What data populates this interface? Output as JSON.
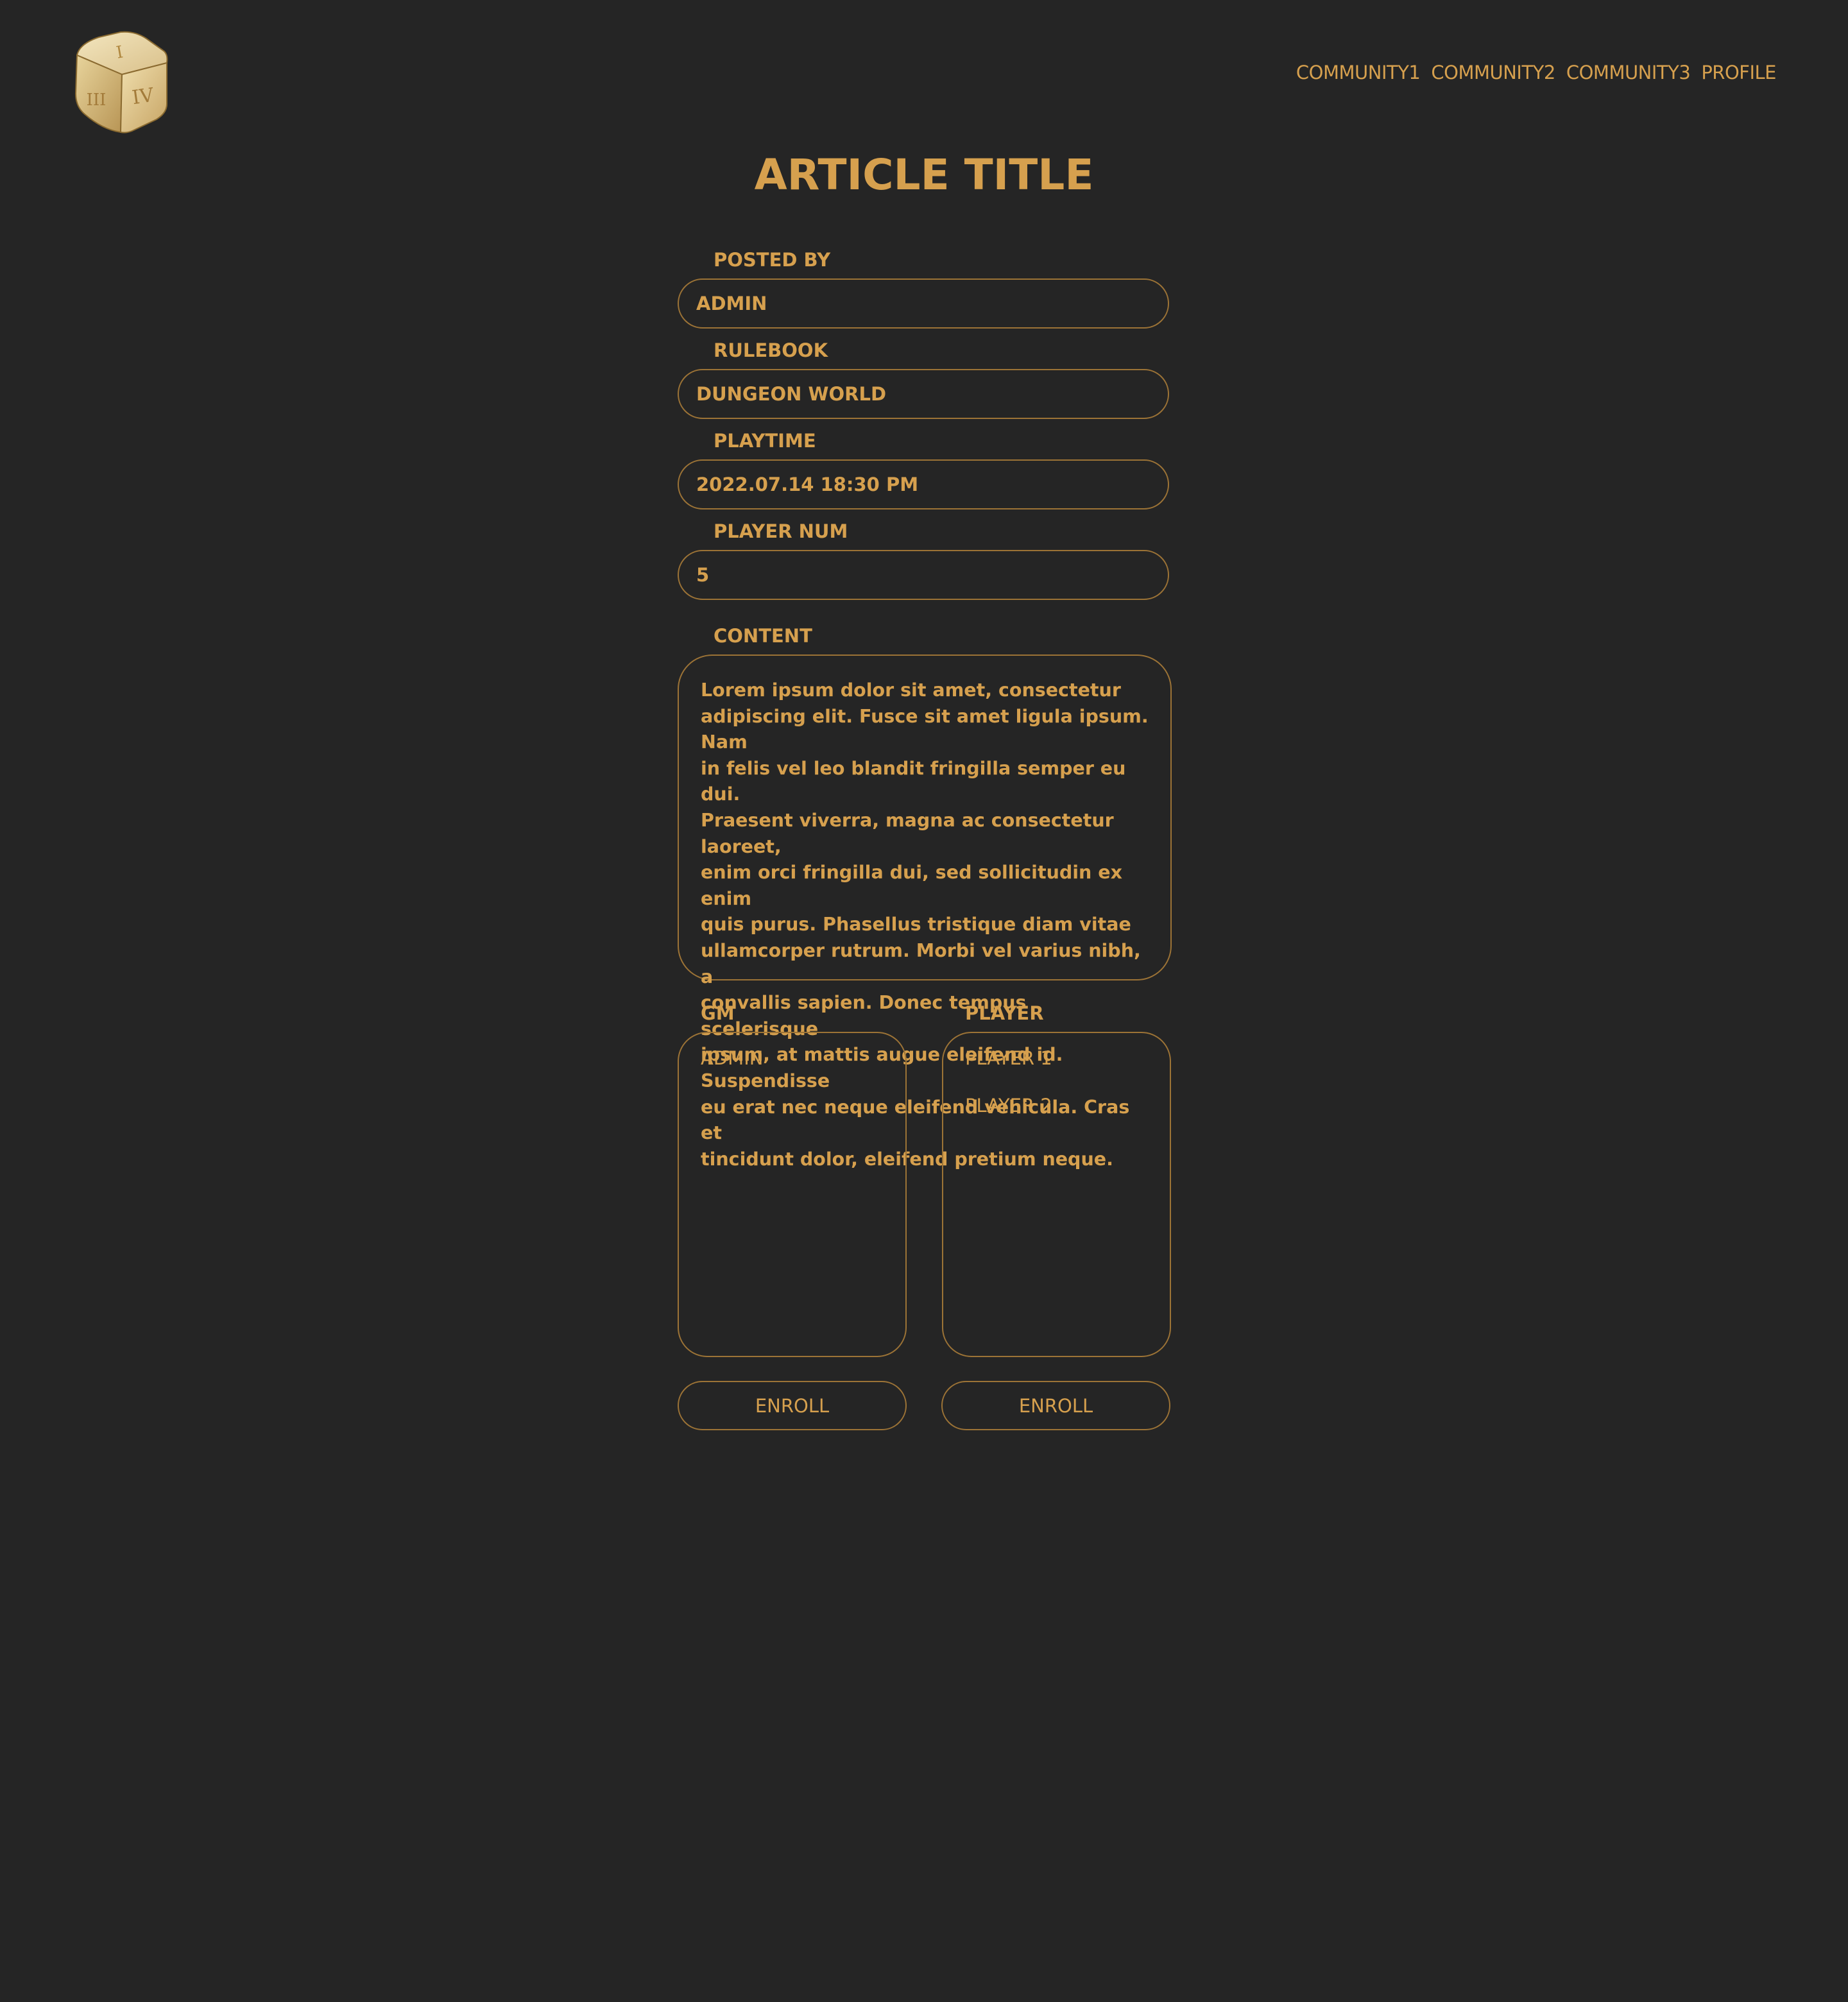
{
  "header": {
    "logo_icon": "dice-logo",
    "nav": [
      {
        "label": "COMMUNITY1"
      },
      {
        "label": "COMMUNITY2"
      },
      {
        "label": "COMMUNITY3"
      },
      {
        "label": "PROFILE"
      }
    ]
  },
  "article": {
    "title": "ARTICLE TITLE",
    "posted_by": {
      "label": "POSTED BY",
      "value": "ADMIN"
    },
    "rulebook": {
      "label": "RULEBOOK",
      "value": "DUNGEON WORLD"
    },
    "playtime": {
      "label": "PLAYTIME",
      "value": "2022.07.14 18:30 PM"
    },
    "player_num": {
      "label": "PLAYER NUM",
      "value": "5"
    },
    "content": {
      "label": "CONTENT",
      "lines": [
        "Lorem ipsum dolor sit amet, consectetur",
        "adipiscing elit. Fusce sit amet ligula ipsum. Nam",
        "in felis vel leo blandit fringilla semper eu dui.",
        "Praesent viverra, magna ac consectetur laoreet,",
        "enim orci fringilla dui, sed sollicitudin ex enim",
        "quis purus. Phasellus tristique diam vitae",
        "ullamcorper rutrum. Morbi vel varius nibh, a",
        "convallis sapien. Donec tempus scelerisque",
        "ipsum, at mattis augue eleifend id. Suspendisse",
        "eu erat nec neque eleifend vehicula. Cras et",
        "tincidunt dolor, eleifend pretium neque."
      ]
    }
  },
  "gm": {
    "label": "GM",
    "members": [
      "ADMIN"
    ],
    "enroll_label": "ENROLL"
  },
  "player": {
    "label": "PLAYER",
    "members": [
      "PLAYER 1",
      "PLAYER 2"
    ],
    "enroll_label": "ENROLL"
  },
  "colors": {
    "background": "#252525",
    "accent": "#d6a04e",
    "border": "#9c7336"
  }
}
